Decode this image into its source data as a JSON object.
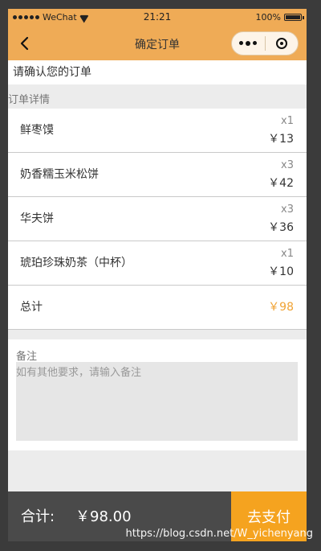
{
  "status": {
    "carrier": "WeChat",
    "time": "21:21",
    "battery": "100%"
  },
  "nav": {
    "title": "确定订单"
  },
  "confirm_text": "请确认您的订单",
  "order": {
    "section_title": "订单详情",
    "items": [
      {
        "name": "鲜枣馍",
        "qty": "x1",
        "price": "￥13"
      },
      {
        "name": "奶香糯玉米松饼",
        "qty": "x3",
        "price": "￥42"
      },
      {
        "name": "华夫饼",
        "qty": "x3",
        "price": "￥36"
      },
      {
        "name": "琥珀珍珠奶茶（中杯）",
        "qty": "x1",
        "price": "￥10"
      }
    ],
    "total_label": "总计",
    "total_amount": "￥98"
  },
  "remark": {
    "label": "备注",
    "placeholder": "如有其他要求，请输入备注"
  },
  "bottom": {
    "sum_label": "合计:",
    "sum_value": "￥98.00",
    "pay_label": "去支付"
  },
  "watermark": "https://blog.csdn.net/W_yichenyang",
  "colors": {
    "brand": "#efab56",
    "accent": "#f5a31f",
    "total": "#f0a334",
    "bottom_bar": "#4a4a4a"
  }
}
